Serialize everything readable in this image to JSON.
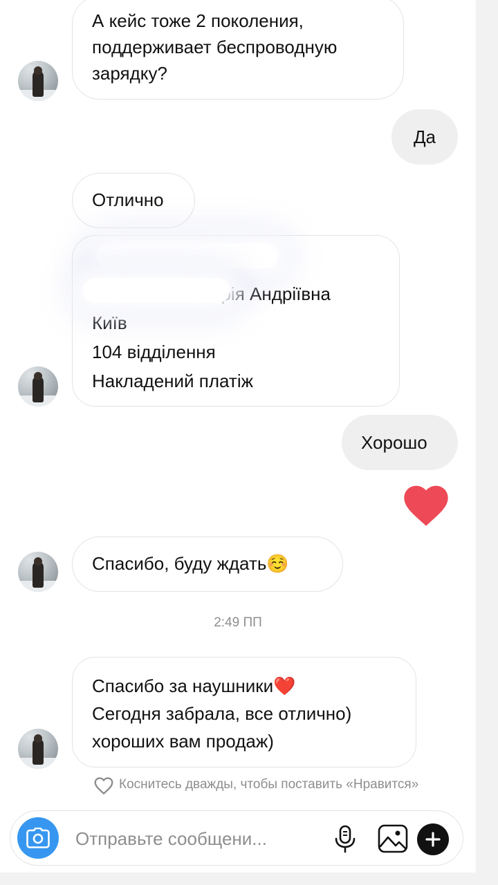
{
  "messages": [
    {
      "from": "them",
      "lines": [
        "А кейс тоже 2 поколения,",
        "поддерживает беспроводную",
        "зарядку?"
      ]
    },
    {
      "from": "me",
      "lines": [
        "Да"
      ]
    },
    {
      "from": "them",
      "lines": [
        "Отлично"
      ]
    },
    {
      "from": "them",
      "lines": [
        "",
        "ерія Андріївна",
        "Київ",
        "104 відділення",
        "Накладений платіж"
      ]
    },
    {
      "from": "me",
      "lines": [
        "Хорошо"
      ]
    },
    {
      "from": "me",
      "reaction": "heart"
    },
    {
      "from": "them",
      "lines": [
        "Спасибо, буду ждать☺️"
      ]
    },
    {
      "from": "them",
      "lines": [
        "Спасибо за наушники❤️",
        "Сегодня забрала, все отлично)",
        "хороших вам продаж)"
      ]
    }
  ],
  "timestamp": "2:49 ПП",
  "like_hint": "Коснитесь дважды, чтобы поставить «Нравится»",
  "composer": {
    "placeholder": "Отправьте сообщени...",
    "camera_icon": "camera-icon",
    "mic_icon": "microphone-icon",
    "gallery_icon": "gallery-icon",
    "plus_icon": "plus-icon"
  },
  "colors": {
    "accent": "#3797f0",
    "heart": "#ed4956",
    "outgoing_bubble": "#efefef",
    "muted_text": "#8e8e8e"
  }
}
